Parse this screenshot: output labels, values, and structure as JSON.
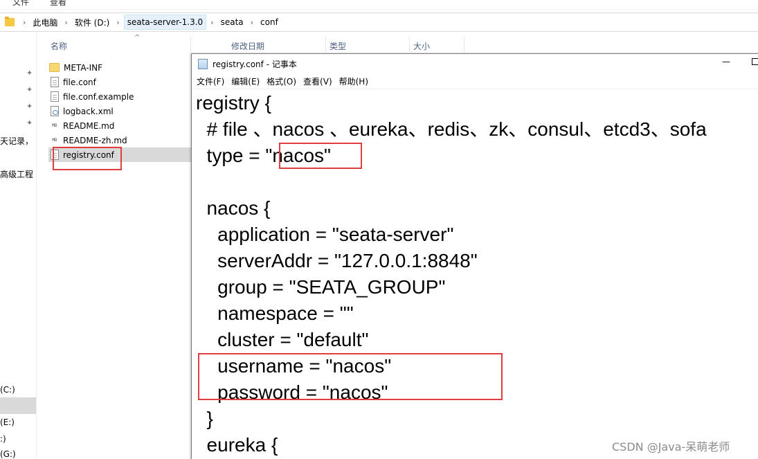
{
  "top_strip": {
    "items": [
      "文件",
      "查看"
    ]
  },
  "address_bar": {
    "crumbs": [
      "此电脑",
      "软件 (D:)",
      "seata-server-1.3.0",
      "seata",
      "conf"
    ],
    "separator": "›"
  },
  "nav_pane": {
    "text_1": "天记录，",
    "text_2": "高级工程",
    "drive_c": "(C:)",
    "drive_e": "(E:)",
    "drive_x": ":)",
    "drive_g": "(G:)",
    "pin_glyph": "📌"
  },
  "file_list": {
    "columns": [
      "名称",
      "修改日期",
      "类型",
      "大小"
    ],
    "sort_glyph": "^",
    "files": [
      {
        "name": "META-INF",
        "icon": "folder-icon"
      },
      {
        "name": "file.conf",
        "icon": "document-icon"
      },
      {
        "name": "file.conf.example",
        "icon": "document-icon"
      },
      {
        "name": "logback.xml",
        "icon": "xml-file-icon"
      },
      {
        "name": "README.md",
        "icon": "markdown-file-icon"
      },
      {
        "name": "README-zh.md",
        "icon": "markdown-file-icon"
      },
      {
        "name": "registry.conf",
        "icon": "document-icon",
        "selected": true
      }
    ],
    "md_glyph": "MD"
  },
  "notepad": {
    "title": "registry.conf - 记事本",
    "minimize_glyph": "—",
    "menu": [
      "文件(F)",
      "编辑(E)",
      "格式(O)",
      "查看(V)",
      "帮助(H)"
    ],
    "lines": [
      "registry {",
      "  # file 、nacos 、eureka、redis、zk、consul、etcd3、sofa",
      "  type = \"nacos\"",
      "",
      "  nacos {",
      "    application = \"seata-server\"",
      "    serverAddr = \"127.0.0.1:8848\"",
      "    group = \"SEATA_GROUP\"",
      "    namespace = \"\"",
      "    cluster = \"default\"",
      "    username = \"nacos\"",
      "    password = \"nacos\"",
      "  }",
      "  eureka {"
    ]
  },
  "watermark": "CSDN @Java-呆萌老师",
  "colors": {
    "highlight_red": "#e03c3c",
    "selection_gray": "#d9d9d9",
    "header_blue": "#4d6082"
  }
}
